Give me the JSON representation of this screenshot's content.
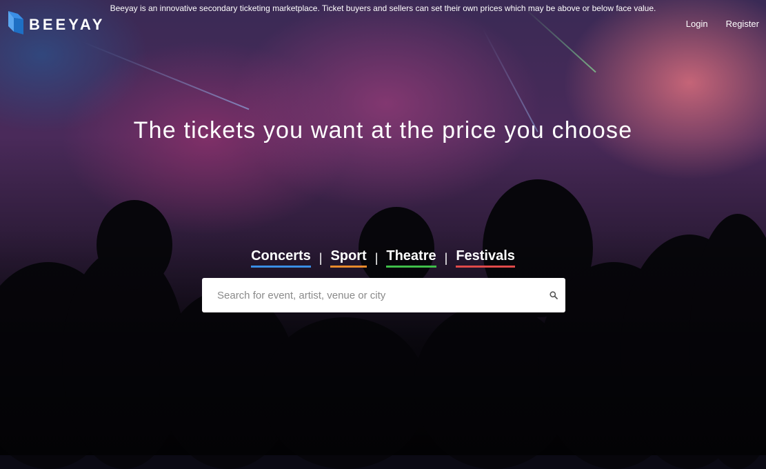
{
  "header": {
    "tagline": "Beeyay is an innovative secondary ticketing marketplace. Ticket buyers and sellers can set their own prices which may be above or below face value.",
    "logo_text": "BEEYAY",
    "login_label": "Login",
    "register_label": "Register"
  },
  "hero": {
    "headline": "The tickets you want at the price you choose"
  },
  "categories": {
    "items": [
      {
        "label": "Concerts",
        "underline_color": "#3a8ee6"
      },
      {
        "label": "Sport",
        "underline_color": "#e98a2c"
      },
      {
        "label": "Theatre",
        "underline_color": "#3fbf4a"
      },
      {
        "label": "Festivals",
        "underline_color": "#e04a4a"
      }
    ],
    "separator": "|"
  },
  "search": {
    "placeholder": "Search for event, artist, venue or city",
    "value": "",
    "icon": "search-icon"
  },
  "colors": {
    "logo_accent": "#3a8ee6",
    "search_bg": "#ffffff"
  }
}
